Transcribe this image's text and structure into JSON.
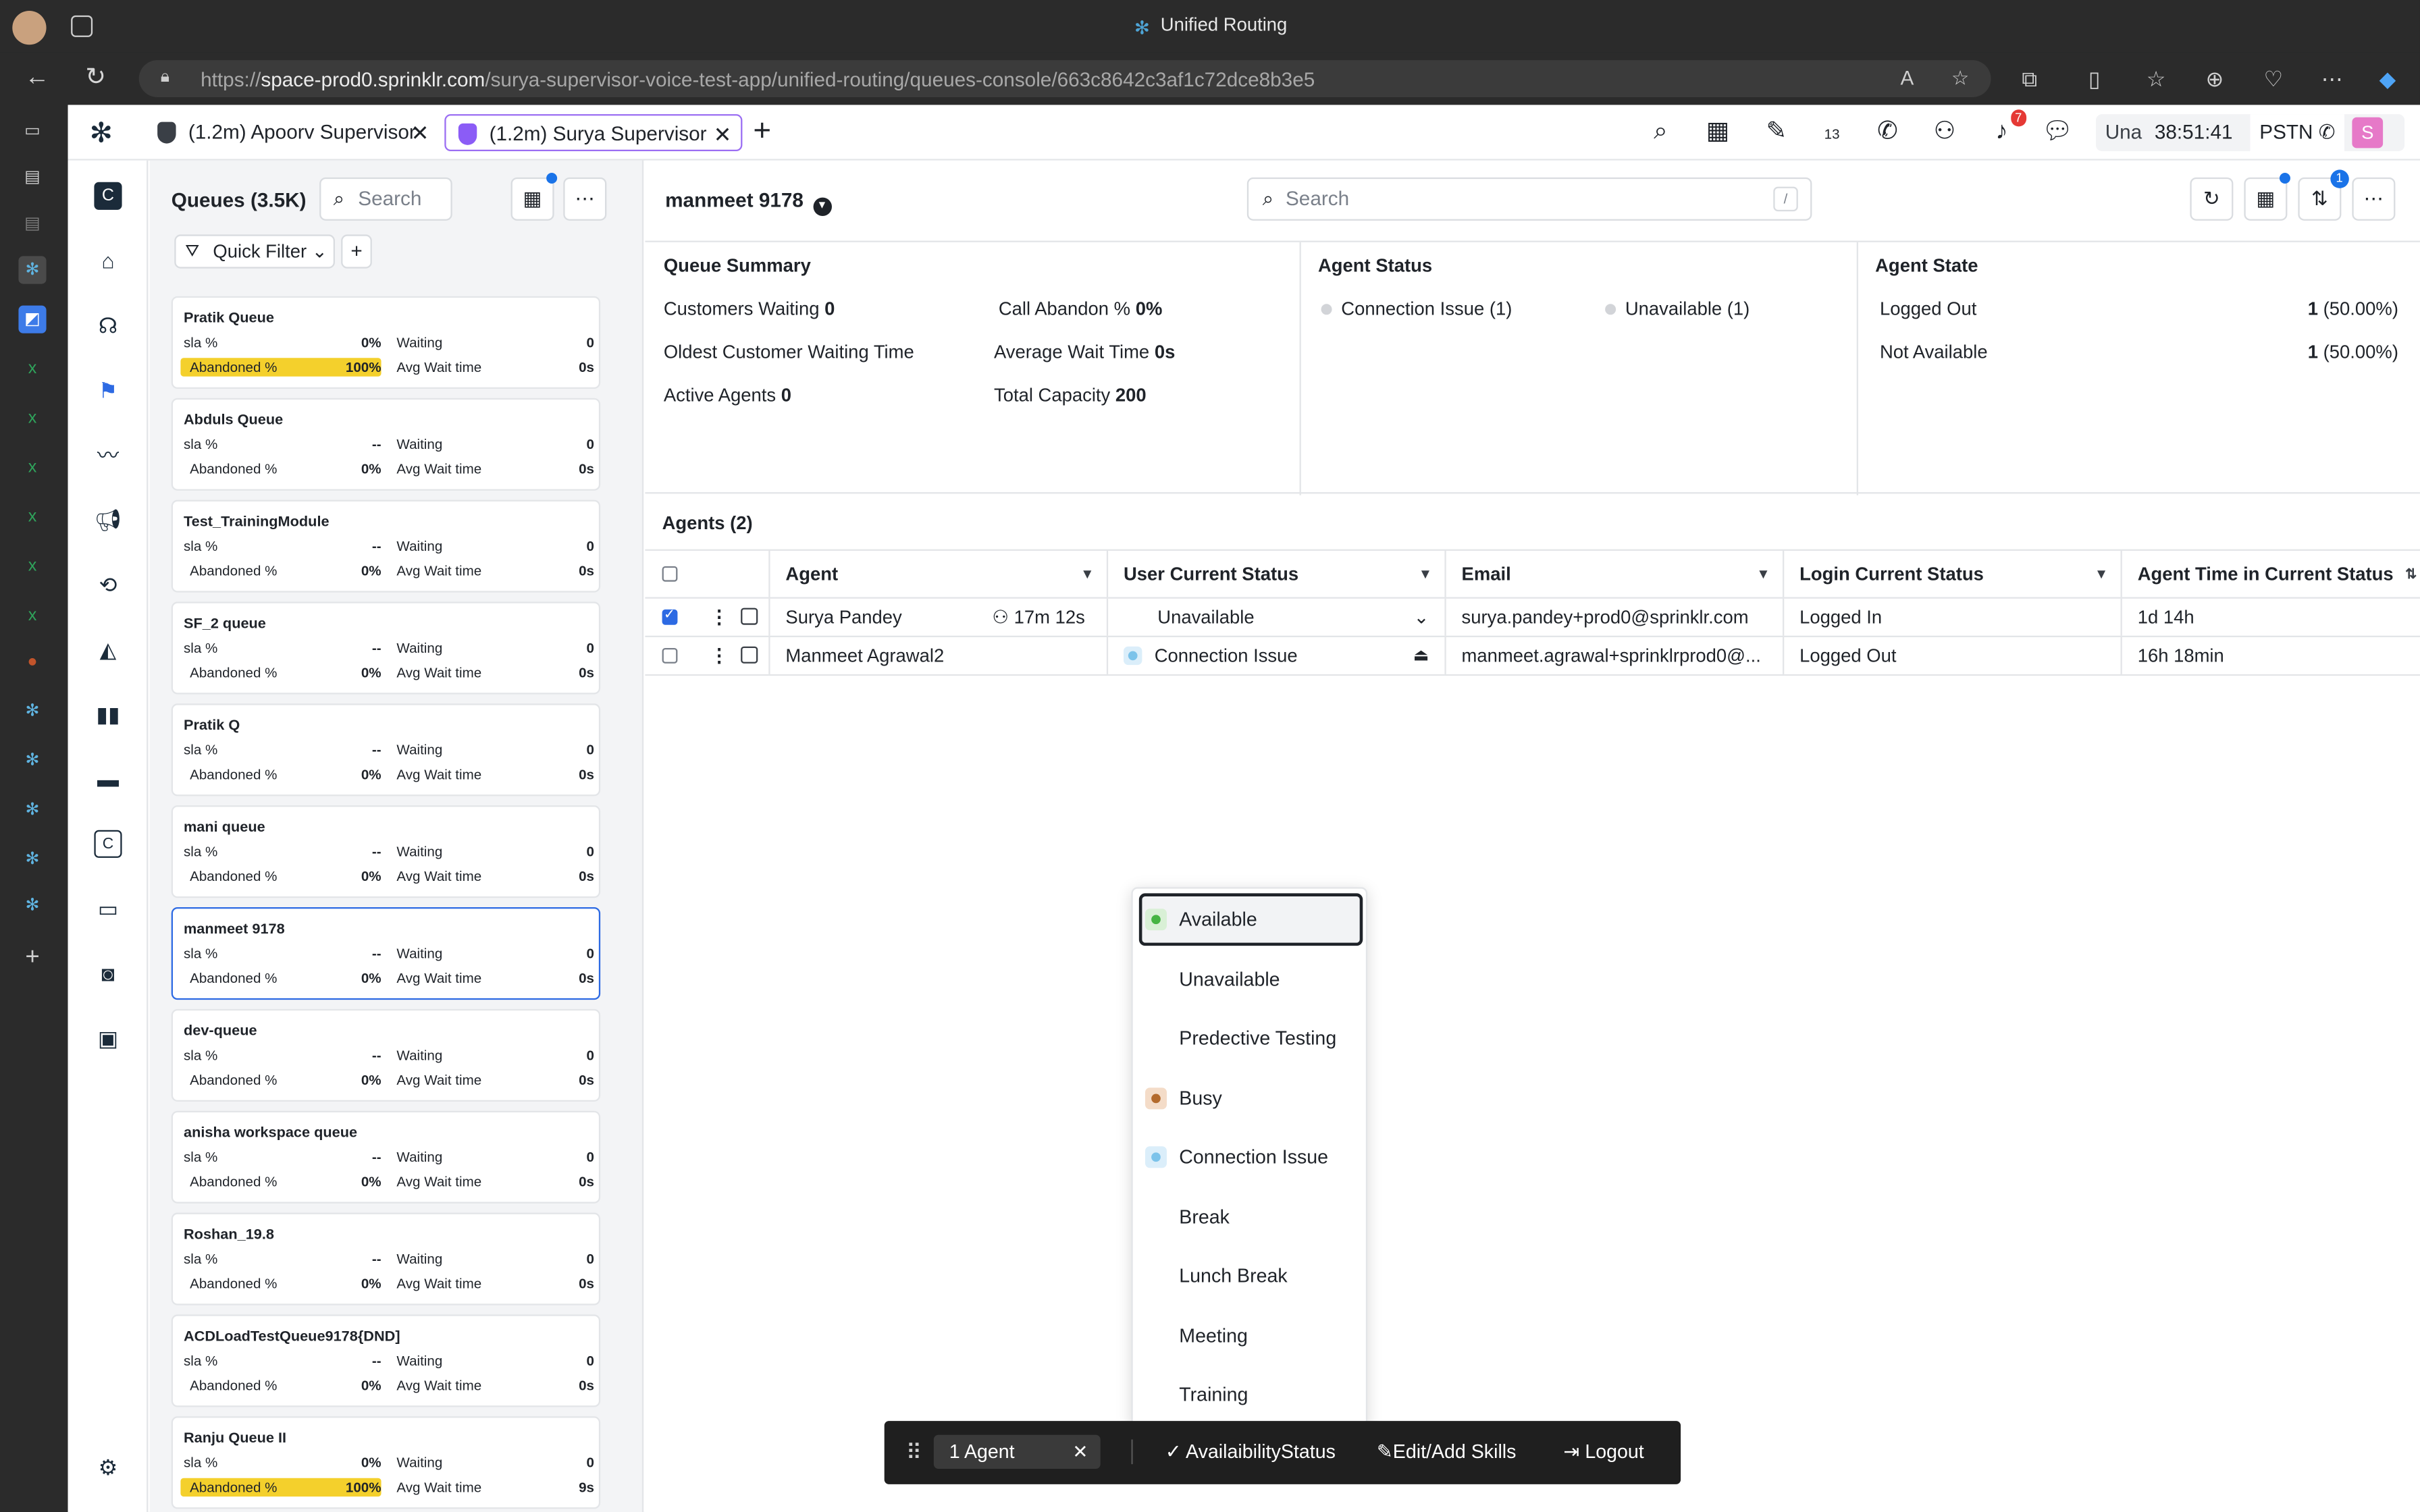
{
  "browser": {
    "window_title": "Unified Routing",
    "url_prefix": "https://",
    "url_host": "space-prod0.sprinklr.com",
    "url_path": "/surya-supervisor-voice-test-app/unified-routing/queues-console/663c8642c3af1c72dce8b3e5"
  },
  "app_tabs": [
    {
      "label": "(1.2m) Apoorv Supervisor",
      "active": false
    },
    {
      "label": "(1.2m) Surya Supervisor",
      "active": true
    }
  ],
  "topbar": {
    "notification_count": "7",
    "calendar_day": "13",
    "status_short": "Una",
    "timer": "38:51:41",
    "line_type": "PSTN",
    "user_initial": "S"
  },
  "queues_panel": {
    "title": "Queues (3.5K)",
    "search_placeholder": "Search",
    "quick_filter_label": "Quick Filter",
    "labels": {
      "sla": "sla %",
      "abandoned": "Abandoned %",
      "waiting": "Waiting",
      "avg_wait": "Avg Wait time"
    },
    "queues": [
      {
        "name": "Pratik Queue",
        "sla": "0%",
        "abandoned": "100%",
        "waiting": "0",
        "avg_wait": "0s",
        "highlight": true
      },
      {
        "name": "Abduls Queue",
        "sla": "--",
        "abandoned": "0%",
        "waiting": "0",
        "avg_wait": "0s"
      },
      {
        "name": "Test_TrainingModule",
        "sla": "--",
        "abandoned": "0%",
        "waiting": "0",
        "avg_wait": "0s"
      },
      {
        "name": "SF_2 queue",
        "sla": "--",
        "abandoned": "0%",
        "waiting": "0",
        "avg_wait": "0s"
      },
      {
        "name": "Pratik Q",
        "sla": "--",
        "abandoned": "0%",
        "waiting": "0",
        "avg_wait": "0s"
      },
      {
        "name": "mani queue",
        "sla": "--",
        "abandoned": "0%",
        "waiting": "0",
        "avg_wait": "0s"
      },
      {
        "name": "manmeet 9178",
        "sla": "--",
        "abandoned": "0%",
        "waiting": "0",
        "avg_wait": "0s",
        "selected": true
      },
      {
        "name": "dev-queue",
        "sla": "--",
        "abandoned": "0%",
        "waiting": "0",
        "avg_wait": "0s"
      },
      {
        "name": "anisha workspace queue",
        "sla": "--",
        "abandoned": "0%",
        "waiting": "0",
        "avg_wait": "0s"
      },
      {
        "name": "Roshan_19.8",
        "sla": "--",
        "abandoned": "0%",
        "waiting": "0",
        "avg_wait": "0s"
      },
      {
        "name": "ACDLoadTestQueue9178{DND]",
        "sla": "--",
        "abandoned": "0%",
        "waiting": "0",
        "avg_wait": "0s"
      },
      {
        "name": "Ranju Queue II",
        "sla": "0%",
        "abandoned": "100%",
        "waiting": "0",
        "avg_wait": "9s",
        "highlight": true
      }
    ]
  },
  "main": {
    "queue_title": "manmeet 9178",
    "search_placeholder": "Search",
    "search_shortcut": "/",
    "sort_badge": "1",
    "summary": {
      "title": "Queue Summary",
      "customers_waiting_label": "Customers Waiting",
      "customers_waiting": "0",
      "call_abandon_label": "Call Abandon %",
      "call_abandon": "0%",
      "oldest_wait_label": "Oldest Customer Waiting Time",
      "avg_wait_label": "Average Wait Time",
      "avg_wait": "0s",
      "active_agents_label": "Active Agents",
      "active_agents": "0",
      "total_capacity_label": "Total Capacity",
      "total_capacity": "200"
    },
    "agent_status": {
      "title": "Agent Status",
      "items": [
        "Connection Issue (1)",
        "Unavailable (1)"
      ]
    },
    "agent_state": {
      "title": "Agent State",
      "rows": [
        {
          "label": "Logged Out",
          "count": "1",
          "pct": "(50.00%)"
        },
        {
          "label": "Not Available",
          "count": "1",
          "pct": "(50.00%)"
        }
      ]
    },
    "agents_title": "Agents (2)",
    "columns": [
      "Agent",
      "User Current Status",
      "Email",
      "Login Current Status",
      "Agent Time in Current Status"
    ],
    "agents": [
      {
        "name": "Surya Pandey",
        "timer": "17m 12s",
        "status": "Unavailable",
        "email": "surya.pandey+prod0@sprinklr.com",
        "login": "Logged In",
        "time": "1d 14h",
        "checked": true
      },
      {
        "name": "Manmeet Agrawal2",
        "timer": "",
        "status": "Connection Issue",
        "email": "manmeet.agrawal+sprinklrprod0@...",
        "login": "Logged Out",
        "time": "16h 18min",
        "checked": false
      }
    ]
  },
  "status_menu": {
    "items": [
      {
        "label": "Available",
        "swatch": "green",
        "selected": true
      },
      {
        "label": "Unavailable",
        "swatch": ""
      },
      {
        "label": "Predective Testing",
        "swatch": ""
      },
      {
        "label": "Busy",
        "swatch": "brown"
      },
      {
        "label": "Connection Issue",
        "swatch": "blue"
      },
      {
        "label": "Break",
        "swatch": ""
      },
      {
        "label": "Lunch Break",
        "swatch": ""
      },
      {
        "label": "Meeting",
        "swatch": ""
      },
      {
        "label": "Training",
        "swatch": ""
      }
    ]
  },
  "action_bar": {
    "selection": "1 Agent",
    "availability": "AvailaibilityStatus",
    "skills": "Edit/Add Skills",
    "logout": "Logout"
  },
  "colors": {
    "accent": "#2d6ae3",
    "tab_active_border": "#9b6ef3",
    "highlight_yellow": "#f4d02c",
    "available_green": "#46b443",
    "busy_brown": "#b36a2c",
    "connection_blue": "#7cc3ea"
  }
}
